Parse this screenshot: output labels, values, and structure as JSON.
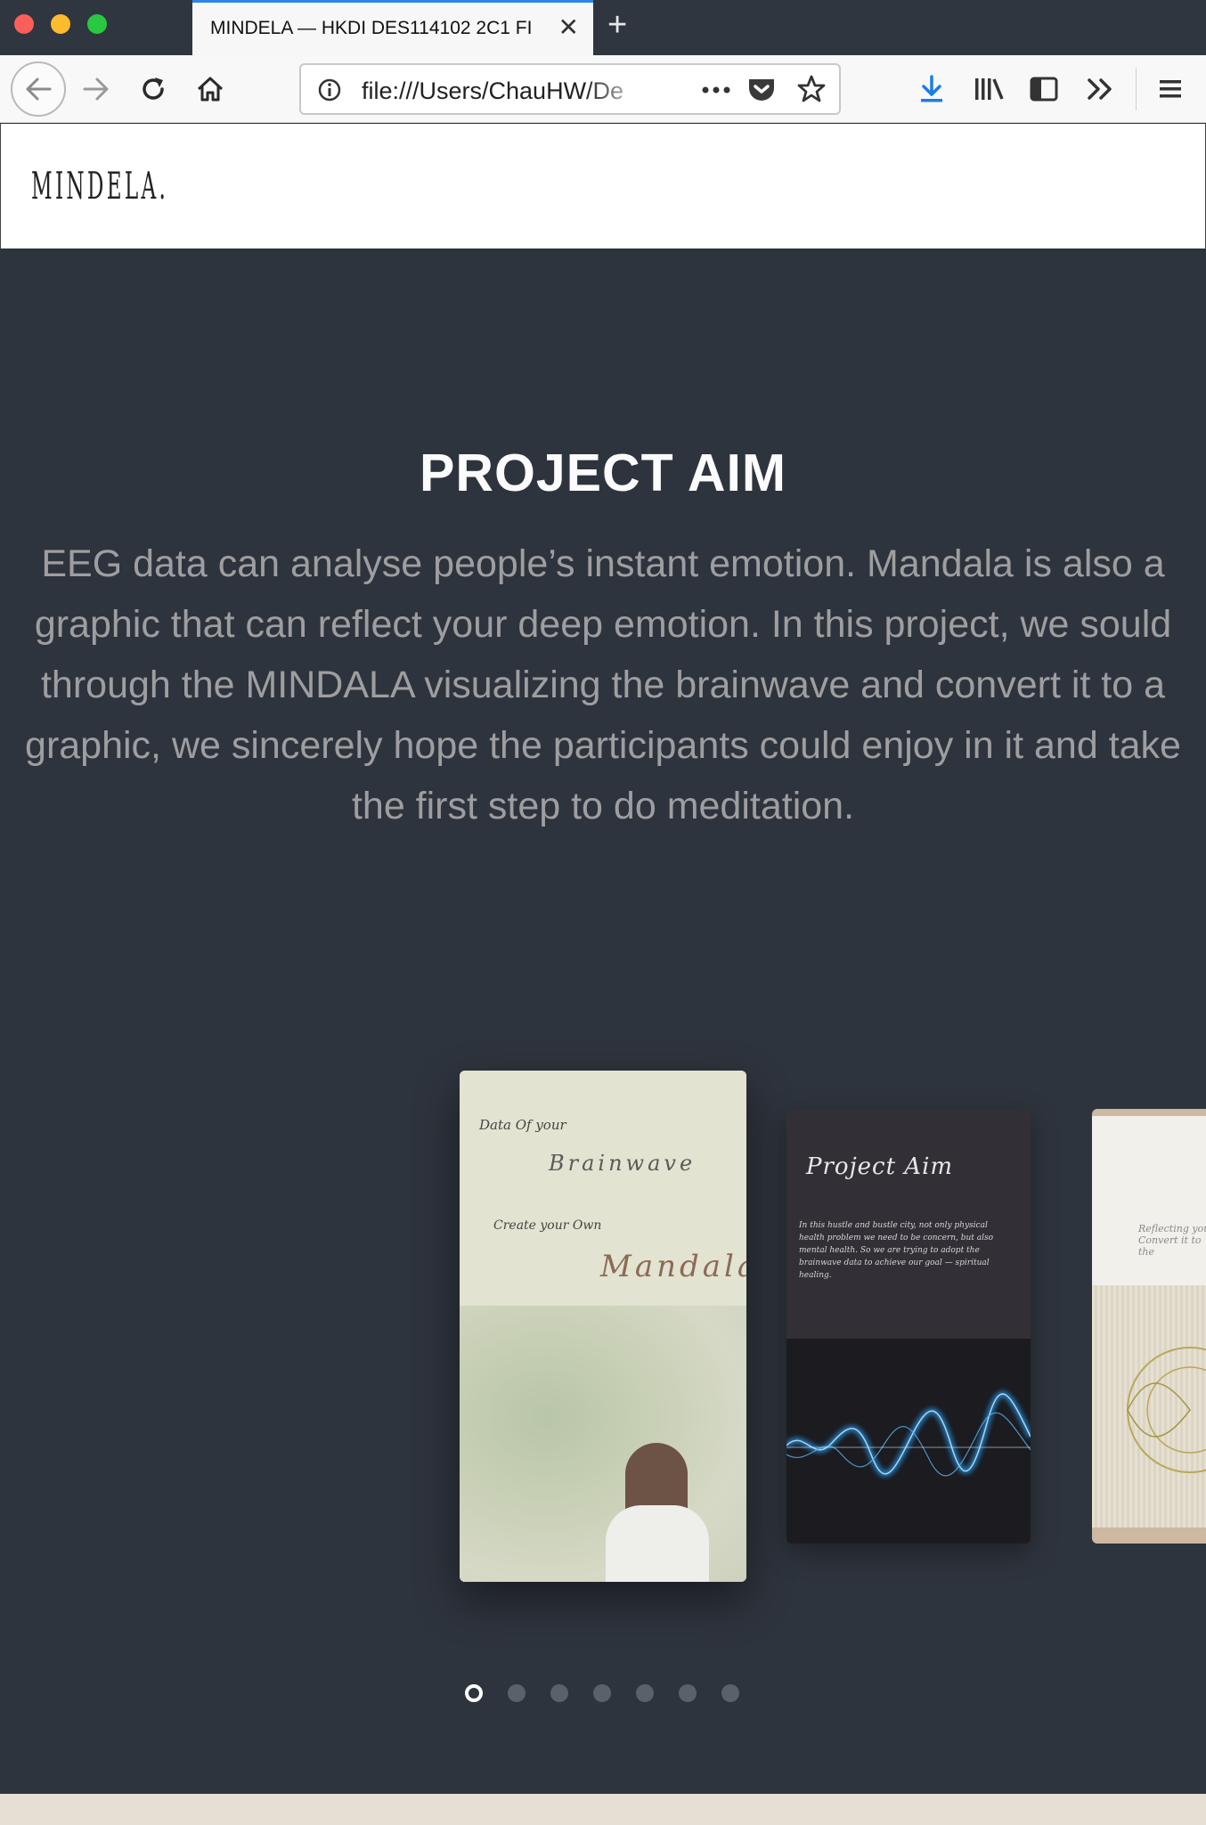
{
  "browser": {
    "tab_title": "MINDELA — HKDI DES114102 2C1 FI",
    "url": "file:///Users/ChauHW/De",
    "new_tab_label": "+",
    "close_label": "✕"
  },
  "site": {
    "logo": "MINDELA."
  },
  "hero": {
    "heading": "PROJECT AIM",
    "body": "EEG data can analyse people’s instant emotion. Mandala is also a graphic that can reflect your deep emotion. In this project, we sould through the MINDALA visualizing the brainwave and convert it to a graphic, we sincerely hope the participants could enjoy in it and take the first step to do meditation."
  },
  "carousel": {
    "card1": {
      "line1": "Data Of your",
      "line2": "Brainwave",
      "line3": "Create your Own",
      "line4": "Mandala"
    },
    "card2": {
      "title": "Project Aim",
      "body": "In this hustle and bustle city, not only physical health problem we need to be concern, but also mental health. So we are trying to adopt the brainwave data to achieve our goal — spiritual healing."
    },
    "card3": {
      "text": "Reflecting your Convert it to the"
    },
    "dot_count": 7,
    "active_index": 0
  },
  "colors": {
    "background": "#2e343d",
    "heading": "#fbfbfb",
    "body_text": "#9e9ea0",
    "accent_tab": "#2e85e8"
  }
}
